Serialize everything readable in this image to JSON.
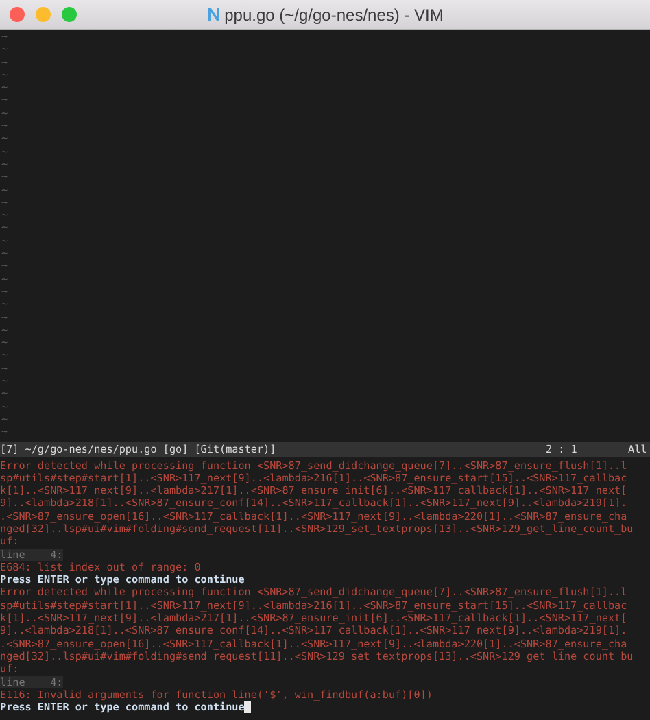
{
  "window": {
    "title": "ppu.go (~/g/go-nes/nes) - VIM"
  },
  "empty_lines": [
    "~",
    "~",
    "~",
    "~",
    "~",
    "~",
    "~",
    "~",
    "~",
    "~",
    "~",
    "~",
    "~",
    "~",
    "~",
    "~",
    "~",
    "~",
    "~",
    "~",
    "~",
    "~",
    "~",
    "~",
    "~",
    "~",
    "~",
    "~",
    "~",
    "~",
    "~",
    "~"
  ],
  "status_line": {
    "left": "[7] ~/g/go-nes/nes/ppu.go [go] [Git(master)]",
    "position": "2 : 1",
    "scroll": "All"
  },
  "messages": [
    {
      "kind": "error",
      "text": "Error detected while processing function <SNR>87_send_didchange_queue[7]..<SNR>87_ensure_flush[1]..l"
    },
    {
      "kind": "error",
      "text": "sp#utils#step#start[1]..<SNR>117_next[9]..<lambda>216[1]..<SNR>87_ensure_start[15]..<SNR>117_callbac"
    },
    {
      "kind": "error",
      "text": "k[1]..<SNR>117_next[9]..<lambda>217[1]..<SNR>87_ensure_init[6]..<SNR>117_callback[1]..<SNR>117_next["
    },
    {
      "kind": "error",
      "text": "9]..<lambda>218[1]..<SNR>87_ensure_conf[14]..<SNR>117_callback[1]..<SNR>117_next[9]..<lambda>219[1]."
    },
    {
      "kind": "error",
      "text": ".<SNR>87_ensure_open[16]..<SNR>117_callback[1]..<SNR>117_next[9]..<lambda>220[1]..<SNR>87_ensure_cha"
    },
    {
      "kind": "error",
      "text": "nged[32]..lsp#ui#vim#folding#send_request[11]..<SNR>129_set_textprops[13]..<SNR>129_get_line_count_bu"
    },
    {
      "kind": "error",
      "text": "uf:"
    },
    {
      "kind": "lineno",
      "text": "line    4:"
    },
    {
      "kind": "error",
      "text": "E684: list index out of range: 0"
    },
    {
      "kind": "prompt",
      "text": "Press ENTER or type command to continue",
      "cursor": false
    },
    {
      "kind": "error",
      "text": "Error detected while processing function <SNR>87_send_didchange_queue[7]..<SNR>87_ensure_flush[1]..l"
    },
    {
      "kind": "error",
      "text": "sp#utils#step#start[1]..<SNR>117_next[9]..<lambda>216[1]..<SNR>87_ensure_start[15]..<SNR>117_callbac"
    },
    {
      "kind": "error",
      "text": "k[1]..<SNR>117_next[9]..<lambda>217[1]..<SNR>87_ensure_init[6]..<SNR>117_callback[1]..<SNR>117_next["
    },
    {
      "kind": "error",
      "text": "9]..<lambda>218[1]..<SNR>87_ensure_conf[14]..<SNR>117_callback[1]..<SNR>117_next[9]..<lambda>219[1]."
    },
    {
      "kind": "error",
      "text": ".<SNR>87_ensure_open[16]..<SNR>117_callback[1]..<SNR>117_next[9]..<lambda>220[1]..<SNR>87_ensure_cha"
    },
    {
      "kind": "error",
      "text": "nged[32]..lsp#ui#vim#folding#send_request[11]..<SNR>129_set_textprops[13]..<SNR>129_get_line_count_bu"
    },
    {
      "kind": "error",
      "text": "uf:"
    },
    {
      "kind": "lineno",
      "text": "line    4:"
    },
    {
      "kind": "error",
      "text": "E116: Invalid arguments for function line('$', win_findbuf(a:buf)[0])"
    },
    {
      "kind": "prompt",
      "text": "Press ENTER or type command to continue",
      "cursor": true
    }
  ]
}
